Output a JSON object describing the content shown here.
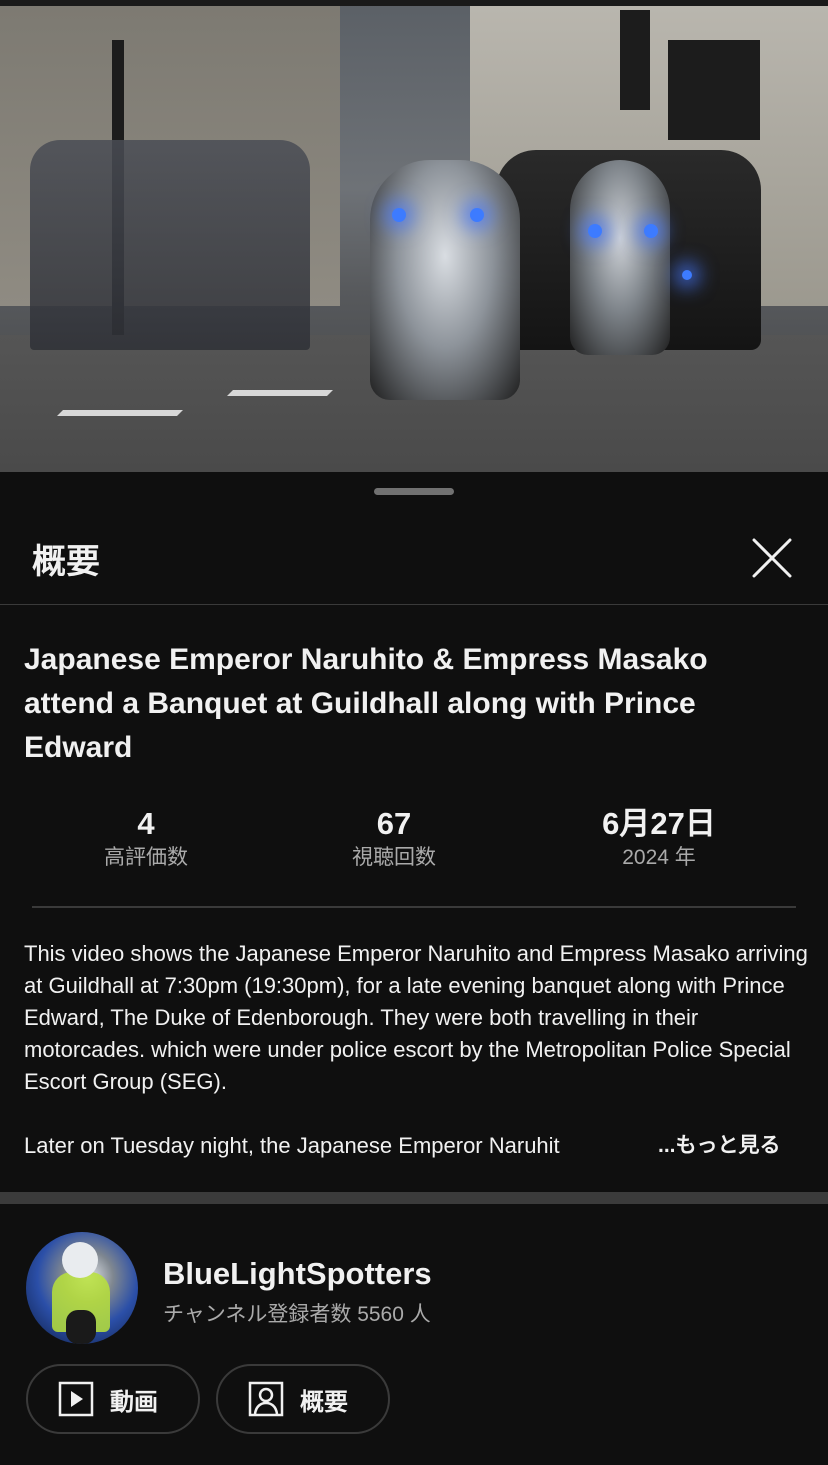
{
  "sheet": {
    "title": "概要"
  },
  "video": {
    "title": "Japanese Emperor Naruhito & Empress Masako attend a Banquet at Guildhall along with Prince Edward"
  },
  "stats": [
    {
      "value": "4",
      "label": "高評価数"
    },
    {
      "value": "67",
      "label": "視聴回数"
    },
    {
      "value": "6月27日",
      "label": "2024 年"
    }
  ],
  "description": {
    "paragraph1": "This video shows the Japanese Emperor Naruhito and Empress Masako arriving at Guildhall at 7:30pm (19:30pm), for a late evening banquet along with Prince Edward, The Duke of Edenborough. They were both travelling in their motorcades. which were under police escort by the Metropolitan Police Special Escort Group (SEG).",
    "paragraph2_truncated": "Later on Tuesday night, the Japanese Emperor Naruhit",
    "more_label": "...もっと見る"
  },
  "channel": {
    "name": "BlueLightSpotters",
    "subscribers": "チャンネル登録者数 5560 人",
    "buttons": {
      "videos_label": "動画",
      "about_label": "概要"
    }
  },
  "colors": {
    "background": "#0f0f0f",
    "text_primary": "#f1f1f1",
    "text_secondary": "#aaaaaa",
    "divider": "#3a3a3a"
  }
}
